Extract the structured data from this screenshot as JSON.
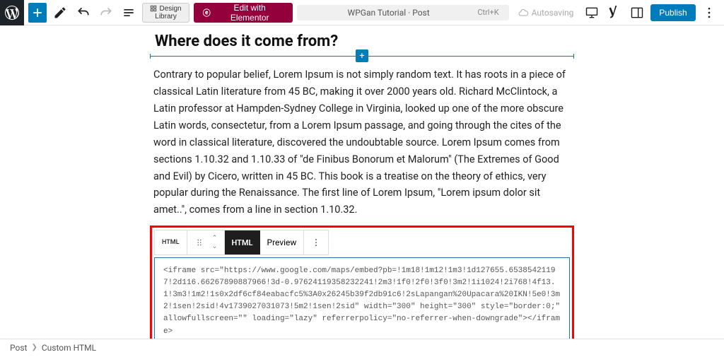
{
  "topbar": {
    "design_library_line1": "Design",
    "design_library_line2": "Library",
    "elementor_label": "Edit with Elementor",
    "doc_title": "WPGan Tutorial · Post",
    "shortcut": "Ctrl+K",
    "autosaving": "Autosaving",
    "publish": "Publish"
  },
  "content": {
    "heading": "Where does it come from?",
    "paragraph": "Contrary to popular belief, Lorem Ipsum is not simply random text. It has roots in a piece of classical Latin literature from 45 BC, making it over 2000 years old. Richard McClintock, a Latin professor at Hampden-Sydney College in Virginia, looked up one of the more obscure Latin words, consectetur, from a Lorem Ipsum passage, and going through the cites of the word in classical literature, discovered the undoubtable source. Lorem Ipsum comes from sections 1.10.32 and 1.10.33 of \"de Finibus Bonorum et Malorum\" (The Extremes of Good and Evil) by Cicero, written in 45 BC. This book is a treatise on the theory of ethics, very popular during the Renaissance. The first line of Lorem Ipsum, \"Lorem ipsum dolor sit amet..\", comes from a line in section 1.10.32."
  },
  "html_block": {
    "toolbar": {
      "type_label": "HTML",
      "tab_html": "HTML",
      "tab_preview": "Preview"
    },
    "code": "<iframe src=\"https://www.google.com/maps/embed?pb=!1m18!1m12!1m3!1d127655.65385421197!2d116.66267890887966!3d-0.97624119358232241!2m3!1f0!2f0!3f0!3m2!1i1024!2i768!4f13.1!3m3!1m2!1s0x2df6cf84eabacfc5%3A0x26245b39f2db91c6!2sLapangan%20Upacara%20IKN!5e0!3m2!1sen!2sid!4v1739027031073!5m2!1sen!2sid\" width=\"300\" height=\"300\" style=\"border:0;\" allowfullscreen=\"\" loading=\"lazy\" referrerpolicy=\"no-referrer-when-downgrade\"></iframe>"
  },
  "breadcrumb": {
    "root": "Post",
    "current": "Custom HTML"
  }
}
